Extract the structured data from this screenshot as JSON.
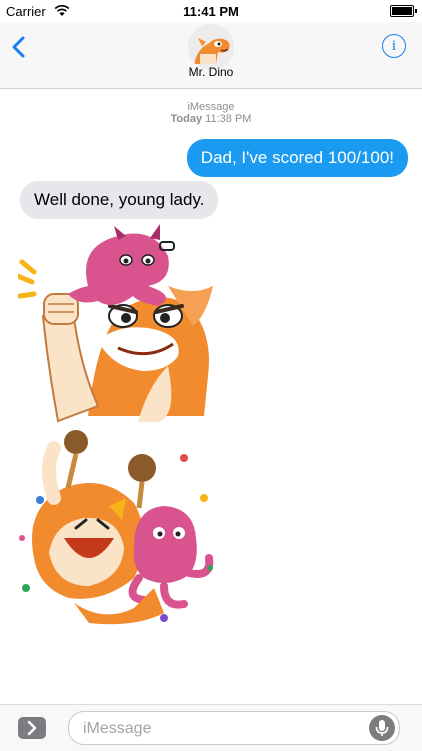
{
  "status": {
    "carrier": "Carrier",
    "time": "11:41 PM"
  },
  "nav": {
    "contact_name": "Mr. Dino",
    "info_label": "i"
  },
  "thread": {
    "service_label": "iMessage",
    "timestamp_day": "Today",
    "timestamp_time": "11:38 PM",
    "messages": [
      {
        "direction": "outgoing",
        "text": "Dad, I've scored 100/100!"
      },
      {
        "direction": "incoming",
        "text": "Well done, young lady."
      }
    ],
    "stickers": [
      "octopus-on-dino-head-sticker",
      "celebrating-dino-octopus-sticker"
    ]
  },
  "compose": {
    "placeholder": "iMessage"
  },
  "colors": {
    "accent": "#1a7cf5",
    "outgoing_bubble": "#1a9af0",
    "incoming_bubble": "#e6e6eb",
    "dino_orange": "#f28a2e",
    "octopus_pink": "#d9548f"
  }
}
